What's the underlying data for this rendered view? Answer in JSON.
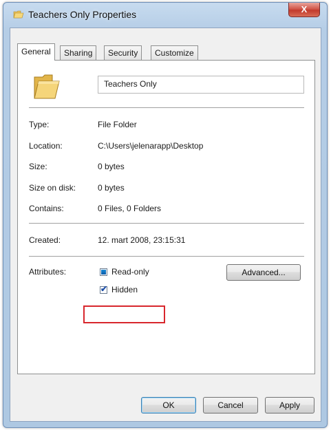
{
  "window": {
    "title": "Teachers Only Properties",
    "close_label": "X"
  },
  "tabs": [
    {
      "label": "General",
      "active": true
    },
    {
      "label": "Sharing",
      "active": false
    },
    {
      "label": "Security",
      "active": false
    },
    {
      "label": "Customize",
      "active": false
    }
  ],
  "general": {
    "folder_name": "Teachers Only",
    "rows": [
      {
        "label": "Type:",
        "value": "File Folder"
      },
      {
        "label": "Location:",
        "value": "C:\\Users\\jelenarapp\\Desktop"
      },
      {
        "label": "Size:",
        "value": "0 bytes"
      },
      {
        "label": "Size on disk:",
        "value": "0 bytes"
      },
      {
        "label": "Contains:",
        "value": "0 Files, 0 Folders"
      }
    ],
    "created_label": "Created:",
    "created_value": "12. mart 2008, 23:15:31",
    "attributes_label": "Attributes:",
    "readonly_label": "Read-only",
    "readonly_state": "indeterminate",
    "hidden_label": "Hidden",
    "hidden_checked": true,
    "advanced_label": "Advanced..."
  },
  "footer": {
    "ok_label": "OK",
    "cancel_label": "Cancel",
    "apply_label": "Apply"
  },
  "colors": {
    "highlight": "#d8262c",
    "titlebar": "#b5cde6",
    "close": "#c23a2c"
  },
  "icons": [
    "folder-icon",
    "close-icon",
    "checkbox-indeterminate",
    "checkbox-checked"
  ]
}
